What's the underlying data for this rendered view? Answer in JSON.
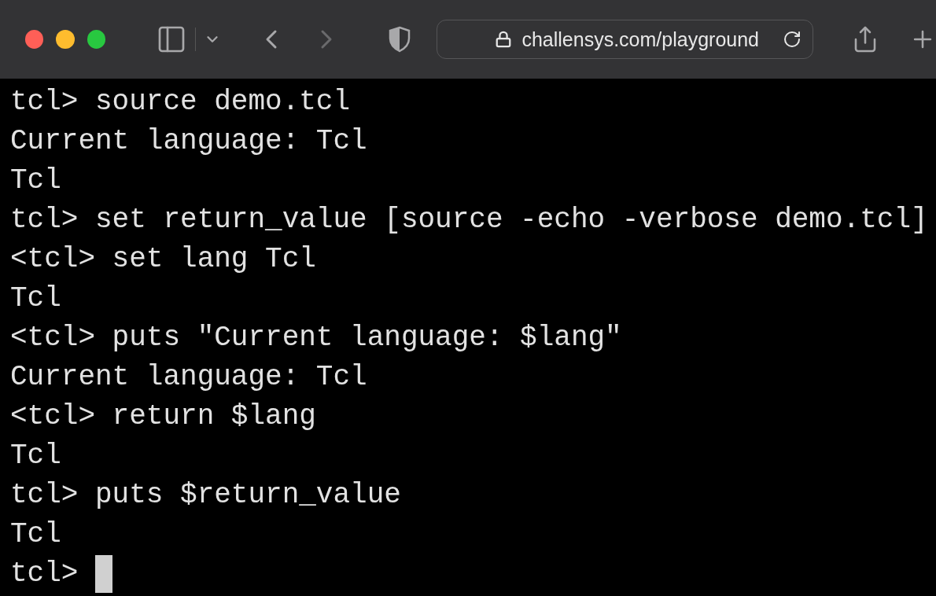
{
  "browser": {
    "url": "challensys.com/playground",
    "back_disabled": false,
    "forward_disabled": true
  },
  "terminal": {
    "lines": [
      "tcl> source demo.tcl",
      "Current language: Tcl",
      "Tcl",
      "tcl> set return_value [source -echo -verbose demo.tcl]",
      "<tcl> set lang Tcl",
      "Tcl",
      "<tcl> puts \"Current language: $lang\"",
      "Current language: Tcl",
      "<tcl> return $lang",
      "Tcl",
      "tcl> puts $return_value",
      "Tcl"
    ],
    "prompt": "tcl>",
    "cursor": true
  }
}
